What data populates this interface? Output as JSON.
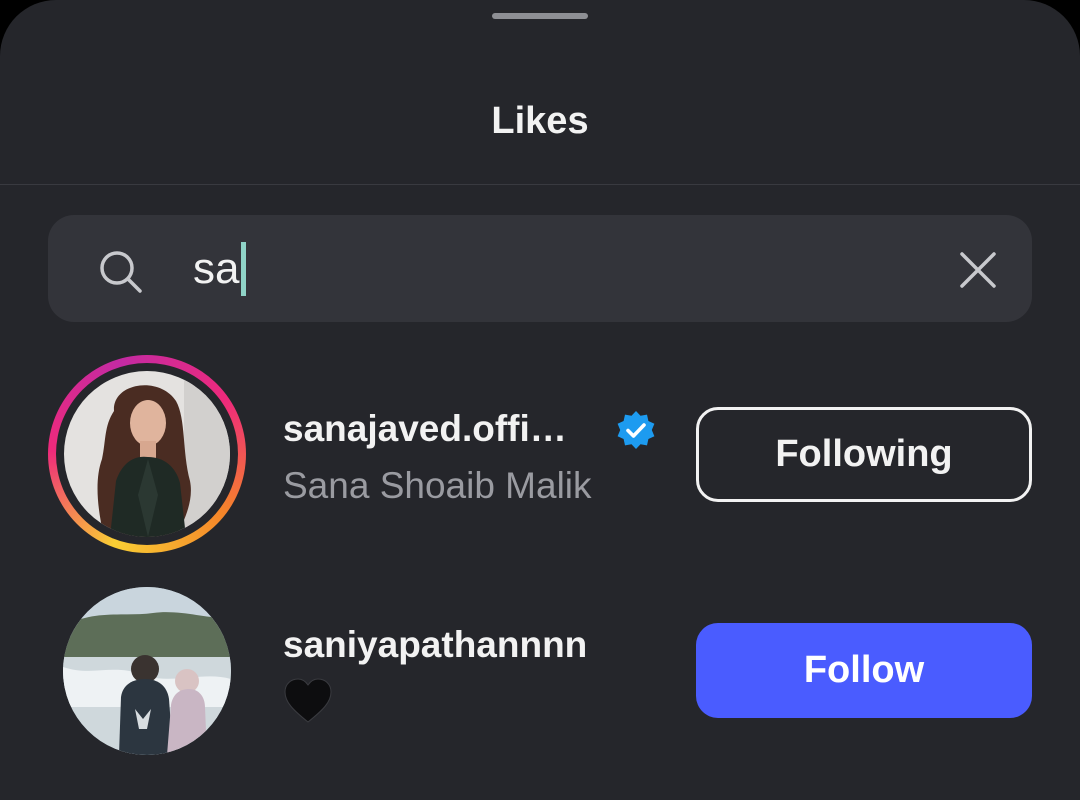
{
  "sheet": {
    "title": "Likes"
  },
  "search": {
    "value": "sa"
  },
  "results": [
    {
      "username": "sanajaved.offi…",
      "full_name": "Sana Shoaib Malik",
      "verified": true,
      "has_story_ring": true,
      "button_label": "Following"
    },
    {
      "username": "saniyapathannnn",
      "bio_emoji": "black-heart-icon",
      "verified": false,
      "has_story_ring": false,
      "button_label": "Follow"
    }
  ],
  "colors": {
    "sheet_background": "#25262b",
    "search_background": "#33343a",
    "follow_button": "#4a5cff",
    "verified_badge": "#1d9bf0",
    "secondary_text": "#9a9ba1"
  }
}
